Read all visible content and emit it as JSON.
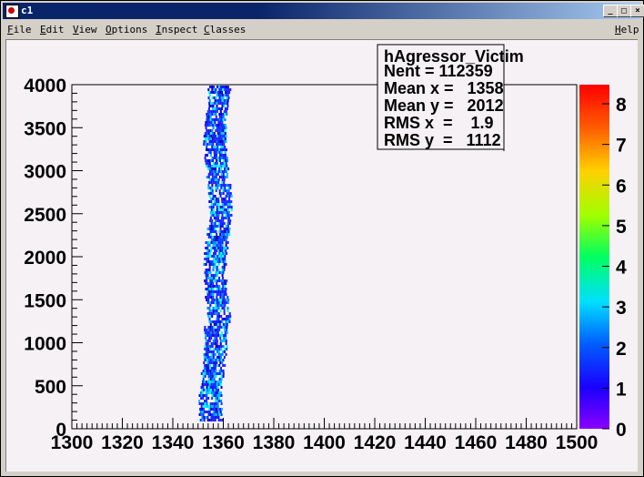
{
  "window": {
    "title": "c1"
  },
  "menu": {
    "file": "File",
    "edit": "Edit",
    "view": "View",
    "options": "Options",
    "inspect": "Inspect",
    "classes": "Classes",
    "help": "Help"
  },
  "stats": {
    "name": "hAgressor_Victim",
    "entries": "Nent = 112359",
    "mean_x": "Mean x =   1358",
    "mean_y": "Mean y =   2012",
    "rms_x": "RMS x  =    1.9",
    "rms_y": "RMS y  =   1112"
  },
  "axes": {
    "y_ticks": [
      "0",
      "500",
      "1000",
      "1500",
      "2000",
      "2500",
      "3000",
      "3500",
      "4000"
    ],
    "x_ticks": [
      "1300",
      "1320",
      "1340",
      "1360",
      "1380",
      "1400",
      "1420",
      "1440",
      "1460",
      "1480",
      "1500"
    ],
    "z_ticks": [
      "0",
      "1",
      "2",
      "3",
      "4",
      "5",
      "6",
      "7",
      "8"
    ]
  }
}
